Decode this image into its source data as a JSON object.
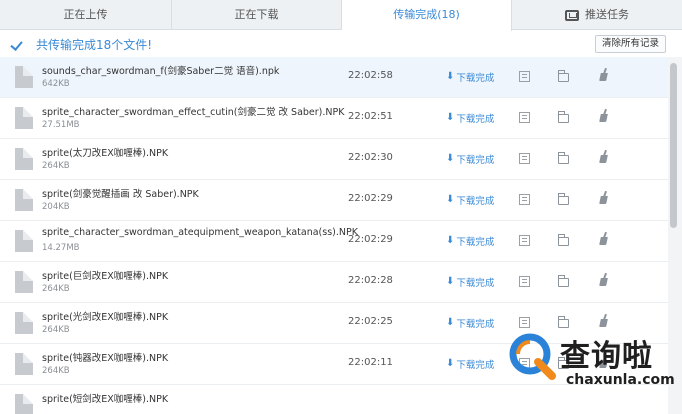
{
  "tabs": [
    {
      "label": "正在上传"
    },
    {
      "label": "正在下载"
    },
    {
      "label": "传输完成(18)"
    },
    {
      "label": "推送任务"
    }
  ],
  "summary": {
    "text": "共传输完成18个文件!",
    "clear_button": "清除所有记录"
  },
  "files": [
    {
      "name": "sounds_char_swordman_f(剑豪Saber二觉 语音).npk",
      "size": "642KB",
      "time": "22:02:58",
      "status": "下载完成"
    },
    {
      "name": "sprite_character_swordman_effect_cutin(剑豪二觉 改 Saber).NPK",
      "size": "27.51MB",
      "time": "22:02:51",
      "status": "下载完成"
    },
    {
      "name": "sprite(太刀改EX咖喱棒).NPK",
      "size": "264KB",
      "time": "22:02:30",
      "status": "下载完成"
    },
    {
      "name": "sprite(剑豪觉醒插画 改 Saber).NPK",
      "size": "204KB",
      "time": "22:02:29",
      "status": "下载完成"
    },
    {
      "name": "sprite_character_swordman_atequipment_weapon_katana(ss).NPK",
      "size": "14.27MB",
      "time": "22:02:29",
      "status": "下载完成"
    },
    {
      "name": "sprite(巨剑改EX咖喱棒).NPK",
      "size": "264KB",
      "time": "22:02:28",
      "status": "下载完成"
    },
    {
      "name": "sprite(光剑改EX咖喱棒).NPK",
      "size": "264KB",
      "time": "22:02:25",
      "status": "下载完成"
    },
    {
      "name": "sprite(钝器改EX咖喱棒).NPK",
      "size": "264KB",
      "time": "22:02:11",
      "status": "下载完成"
    },
    {
      "name": "sprite(短剑改EX咖喱棒).NPK",
      "size": "",
      "time": "",
      "status": ""
    }
  ],
  "icons": {
    "check": "check-icon",
    "push": "push-task-icon",
    "file": "file-icon",
    "detail": "document-icon",
    "folder": "folder-icon",
    "clean": "broom-icon"
  },
  "colors": {
    "accent": "#3a8ad6",
    "selected_row": "#eef5fc",
    "watermark_orange": "#f08a1c",
    "watermark_blue": "#2b82d9"
  },
  "watermark": {
    "text": "查询啦",
    "url": "chaxunla.com"
  }
}
